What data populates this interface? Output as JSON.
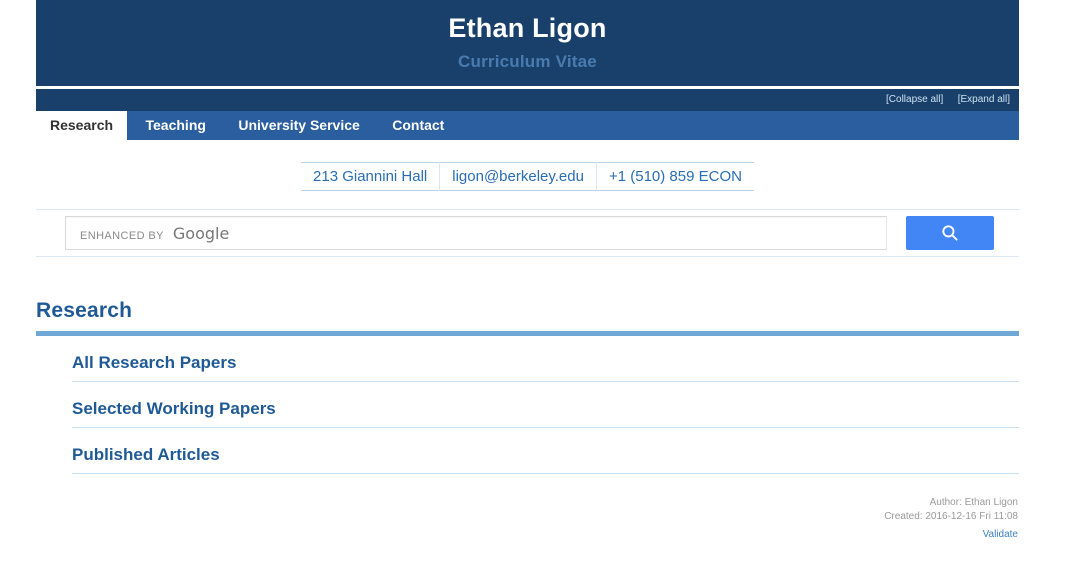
{
  "masthead": {
    "title": "Ethan Ligon",
    "subtitle": "Curriculum Vitae",
    "background_color": "#18406b",
    "subtitle_color": "#4a7bb0"
  },
  "toggle_bar": {
    "collapse_label": "[Collapse all]",
    "expand_label": "[Expand all]"
  },
  "nav": {
    "background_color": "#2a5e9e",
    "tabs": [
      {
        "label": "Research",
        "active": true
      },
      {
        "label": "Teaching",
        "active": false
      },
      {
        "label": "University Service",
        "active": false
      },
      {
        "label": "Contact",
        "active": false
      }
    ]
  },
  "contact": {
    "office": "213 Giannini Hall",
    "email": "ligon@berkeley.edu",
    "phone": "+1 (510) 859 ECON",
    "link_color": "#2a6db5"
  },
  "search": {
    "placeholder": "",
    "value": "",
    "watermark_prefix": "ENHANCED BY",
    "watermark_brand": "Google",
    "button_icon": "search-icon",
    "button_color": "#4285f4"
  },
  "section": {
    "heading": "Research",
    "heading_color": "#1f5a96",
    "rule_color": "#6fa8d6",
    "items": [
      {
        "label": "All Research Papers"
      },
      {
        "label": "Selected Working Papers"
      },
      {
        "label": "Published Articles"
      }
    ]
  },
  "footer": {
    "author": "Author: Ethan Ligon",
    "created": "Created: 2016-12-16 Fri 11:08",
    "validate_label": "Validate",
    "validate_color": "#3f7fc1"
  }
}
